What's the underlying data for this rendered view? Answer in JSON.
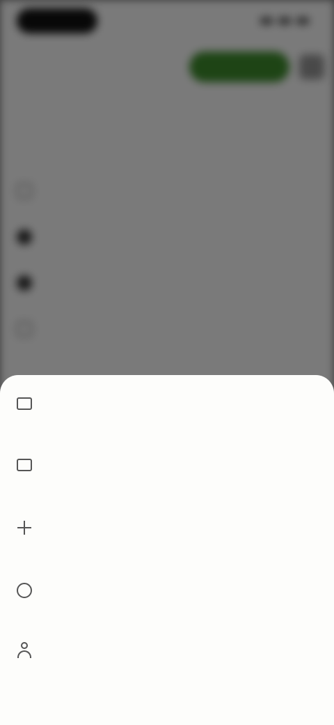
{
  "status_bar": {
    "time": ""
  },
  "background": {
    "header": {
      "primary_button": ""
    },
    "title": "",
    "section_label": "",
    "rows": [
      {
        "label": "",
        "trailing": ""
      },
      {
        "label": "",
        "trailing": ""
      },
      {
        "label": "",
        "trailing": ""
      },
      {
        "label": "",
        "trailing": ""
      }
    ]
  },
  "sheet": {
    "items": [
      {
        "label": "",
        "icon": "folder-icon"
      },
      {
        "label": "",
        "icon": "grid-icon"
      },
      {
        "label": "",
        "icon": "plus-icon"
      },
      {
        "label": "",
        "icon": "info-icon"
      },
      {
        "label": "",
        "icon": "person-icon"
      }
    ]
  },
  "colors": {
    "accent": "#3f8f2d",
    "scrim": "#7a7a7a",
    "sheet": "#fdfdfb"
  }
}
